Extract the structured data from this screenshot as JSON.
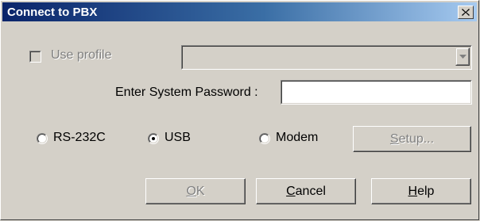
{
  "window": {
    "title": "Connect to PBX",
    "close_icon": "close-icon"
  },
  "profile": {
    "checkbox_label": "Use profile",
    "checked": false,
    "enabled": false,
    "selected_profile": ""
  },
  "password": {
    "label": "Enter System Password :",
    "value": ""
  },
  "connection": {
    "options": [
      {
        "label": "RS-232C",
        "selected": false
      },
      {
        "label": "USB",
        "selected": true
      },
      {
        "label": "Modem",
        "selected": false
      }
    ],
    "setup_button": {
      "mnemonic": "S",
      "rest": "etup...",
      "enabled": false
    }
  },
  "buttons": {
    "ok": {
      "mnemonic": "O",
      "rest": "K",
      "enabled": false
    },
    "cancel": {
      "mnemonic": "C",
      "rest": "ancel",
      "enabled": true
    },
    "help": {
      "mnemonic": "H",
      "rest": "elp",
      "enabled": true
    }
  },
  "colors": {
    "face": "#d4d0c8",
    "titlebar_start": "#0a246a",
    "titlebar_end": "#a6caf0",
    "disabled_text": "#808080"
  }
}
